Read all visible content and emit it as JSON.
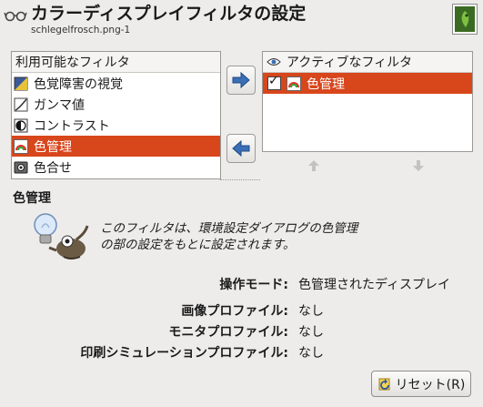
{
  "header": {
    "title": "カラーディスプレイフィルタの設定",
    "subtitle": "schlegelfrosch.png-1",
    "glasses_icon": "glasses-icon",
    "thumbnail_icon": "image-thumbnail"
  },
  "available": {
    "header": "利用可能なフィルタ",
    "items": [
      {
        "label": "色覚障害の視覚",
        "icon": "color-deficient-icon"
      },
      {
        "label": "ガンマ値",
        "icon": "gamma-icon"
      },
      {
        "label": "コントラスト",
        "icon": "contrast-icon"
      },
      {
        "label": "色管理",
        "icon": "color-management-icon",
        "selected": true
      },
      {
        "label": "色合せ",
        "icon": "color-proof-icon"
      }
    ]
  },
  "active": {
    "eye_icon": "eye-icon",
    "header": "アクティブなフィルタ",
    "items": [
      {
        "label": "色管理",
        "checked": true,
        "icon": "color-management-icon",
        "selected": true
      }
    ]
  },
  "buttons": {
    "add_icon": "arrow-right-icon",
    "remove_icon": "arrow-left-icon",
    "move_up_icon": "arrow-up-icon",
    "move_down_icon": "arrow-down-icon",
    "reset_label": "リセット(R)"
  },
  "details": {
    "title": "色管理",
    "description_line1": "このフィルタは、環境設定ダイアログの色管理",
    "description_line2": "の部の設定をもとに設定されます。",
    "fields": [
      {
        "label": "操作モード:",
        "value": "色管理されたディスプレイ"
      },
      {
        "label": "画像プロファイル:",
        "value": "なし"
      },
      {
        "label": "モニタプロファイル:",
        "value": "なし"
      },
      {
        "label": "印刷シミュレーションプロファイル:",
        "value": "なし"
      }
    ]
  },
  "colors": {
    "selection": "#d8461c",
    "arrow_blue": "#3a6fb6"
  }
}
